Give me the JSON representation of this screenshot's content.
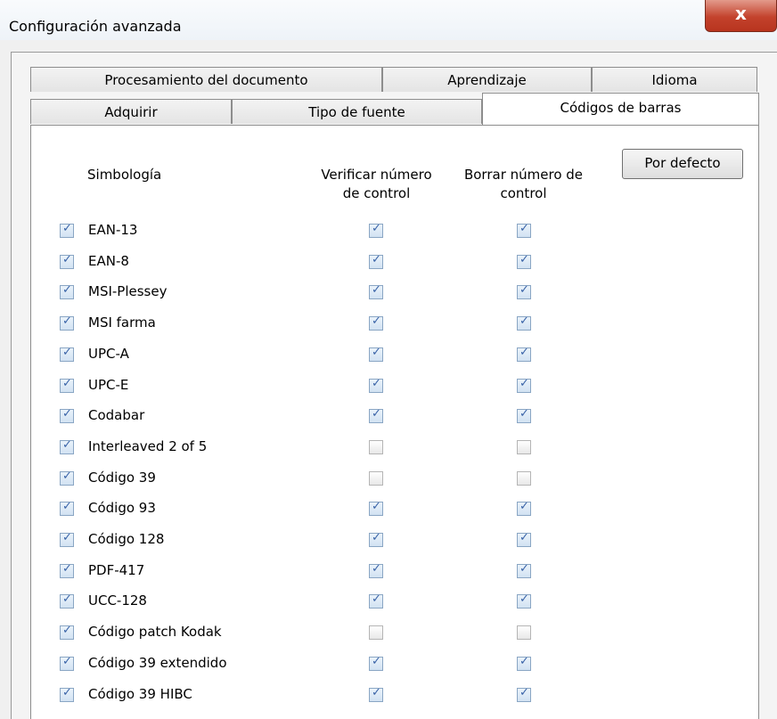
{
  "window": {
    "title": "Configuración avanzada",
    "close_glyph": "x"
  },
  "tabs": {
    "row1": [
      "Procesamiento del documento",
      "Aprendizaje",
      "Idioma"
    ],
    "row2": [
      "Adquirir",
      "Tipo de fuente",
      "Códigos de barras"
    ],
    "selected": "Códigos de barras"
  },
  "panel": {
    "col_symbology": "Simbología",
    "col_verify": "Verificar número de control",
    "col_verify_line1": "Verificar número",
    "col_verify_line2": "de control",
    "col_remove_line1": "Borrar número de",
    "col_remove_line2": "control",
    "defaults_button": "Por defecto"
  },
  "symbologies": [
    {
      "name": "EAN-13",
      "enabled": true,
      "verify": true,
      "remove": true
    },
    {
      "name": "EAN-8",
      "enabled": true,
      "verify": true,
      "remove": true
    },
    {
      "name": "MSI-Plessey",
      "enabled": true,
      "verify": true,
      "remove": true
    },
    {
      "name": "MSI farma",
      "enabled": true,
      "verify": true,
      "remove": true
    },
    {
      "name": "UPC-A",
      "enabled": true,
      "verify": true,
      "remove": true
    },
    {
      "name": "UPC-E",
      "enabled": true,
      "verify": true,
      "remove": true
    },
    {
      "name": "Codabar",
      "enabled": true,
      "verify": true,
      "remove": true
    },
    {
      "name": "Interleaved 2 of 5",
      "enabled": true,
      "verify": false,
      "remove": false
    },
    {
      "name": "Código 39",
      "enabled": true,
      "verify": false,
      "remove": false
    },
    {
      "name": "Código 93",
      "enabled": true,
      "verify": true,
      "remove": true
    },
    {
      "name": "Código 128",
      "enabled": true,
      "verify": true,
      "remove": true
    },
    {
      "name": "PDF-417",
      "enabled": true,
      "verify": true,
      "remove": true
    },
    {
      "name": "UCC-128",
      "enabled": true,
      "verify": true,
      "remove": true
    },
    {
      "name": "Código patch Kodak",
      "enabled": true,
      "verify": false,
      "remove": false
    },
    {
      "name": "Código 39 extendido",
      "enabled": true,
      "verify": true,
      "remove": true
    },
    {
      "name": "Código 39 HIBC",
      "enabled": true,
      "verify": true,
      "remove": true
    }
  ]
}
